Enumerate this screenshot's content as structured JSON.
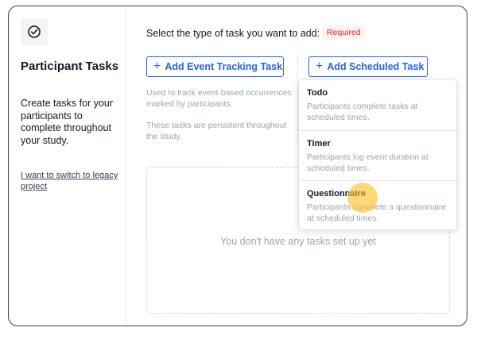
{
  "sidebar": {
    "logo_icon": "check-circle-icon",
    "title": "Participant Tasks",
    "description": "Create tasks for your participants to complete throughout your study.",
    "legacy_link": "I want to switch to legacy project"
  },
  "main": {
    "prompt": "Select the type of task you want to add:",
    "required_label": "Required",
    "event_button": "Add Event Tracking Task",
    "scheduled_button": "Add Scheduled Task",
    "event_description": "Used to track event-based occurrences marked by participants.",
    "event_persistent": "These tasks are persistent throughout the study.",
    "empty_message": "You don't have any tasks set up yet"
  },
  "dropdown": {
    "items": [
      {
        "title": "Todo",
        "description": "Participants complete tasks at scheduled times."
      },
      {
        "title": "Timer",
        "description": "Participants log event duration at scheduled times."
      },
      {
        "title": "Questionnaire",
        "description": "Participants complete a questionnaire at scheduled times."
      }
    ]
  },
  "colors": {
    "accent": "#2563eb",
    "required": "#dc2626",
    "cursor_highlight": "#fbbf24"
  }
}
